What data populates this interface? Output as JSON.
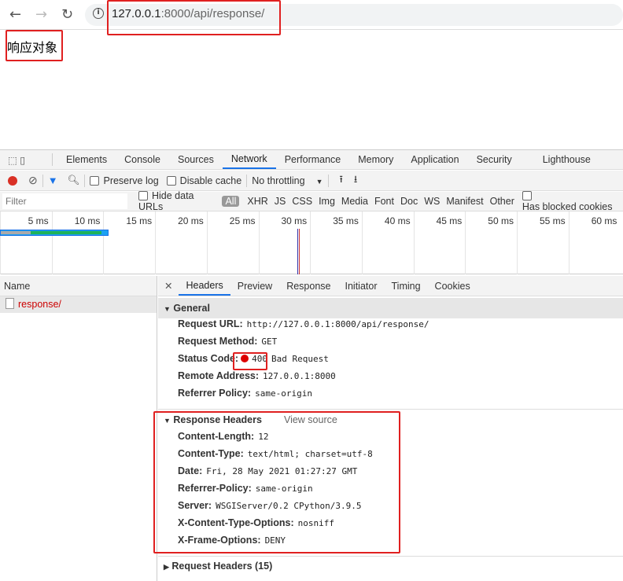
{
  "browser": {
    "url_host": "127.0.0.1",
    "url_rest": ":8000/api/response/"
  },
  "page": {
    "content": "响应对象"
  },
  "devtools": {
    "tabs": [
      "Elements",
      "Console",
      "Sources",
      "Network",
      "Performance",
      "Memory",
      "Application",
      "Security",
      "Lighthouse"
    ],
    "active_tab": "Network",
    "toolbar": {
      "preserve_log": "Preserve log",
      "disable_cache": "Disable cache",
      "throttling": "No throttling"
    },
    "filter": {
      "placeholder": "Filter",
      "hide_data_urls": "Hide data URLs",
      "types": [
        "All",
        "XHR",
        "JS",
        "CSS",
        "Img",
        "Media",
        "Font",
        "Doc",
        "WS",
        "Manifest",
        "Other"
      ],
      "has_blocked_cookies": "Has blocked cookies"
    },
    "timeline": {
      "ticks": [
        "5 ms",
        "10 ms",
        "15 ms",
        "20 ms",
        "25 ms",
        "30 ms",
        "35 ms",
        "40 ms",
        "45 ms",
        "50 ms",
        "55 ms",
        "60 ms"
      ]
    },
    "name_header": "Name",
    "requests": [
      {
        "name": "response/"
      }
    ],
    "detail_tabs": [
      "Headers",
      "Preview",
      "Response",
      "Initiator",
      "Timing",
      "Cookies"
    ],
    "general": {
      "title": "General",
      "rows": [
        {
          "k": "Request URL:",
          "v": "http://127.0.0.1:8000/api/response/"
        },
        {
          "k": "Request Method:",
          "v": "GET"
        },
        {
          "k": "Status Code:",
          "code": "400",
          "v": "Bad Request"
        },
        {
          "k": "Remote Address:",
          "v": "127.0.0.1:8000"
        },
        {
          "k": "Referrer Policy:",
          "v": "same-origin"
        }
      ]
    },
    "response_headers": {
      "title": "Response Headers",
      "view_source": "View source",
      "rows": [
        {
          "k": "Content-Length:",
          "v": "12"
        },
        {
          "k": "Content-Type:",
          "v": "text/html; charset=utf-8"
        },
        {
          "k": "Date:",
          "v": "Fri, 28 May 2021 01:27:27 GMT"
        },
        {
          "k": "Referrer-Policy:",
          "v": "same-origin"
        },
        {
          "k": "Server:",
          "v": "WSGIServer/0.2 CPython/3.9.5"
        },
        {
          "k": "X-Content-Type-Options:",
          "v": "nosniff"
        },
        {
          "k": "X-Frame-Options:",
          "v": "DENY"
        }
      ]
    },
    "request_headers": {
      "title": "Request Headers (15)"
    }
  }
}
